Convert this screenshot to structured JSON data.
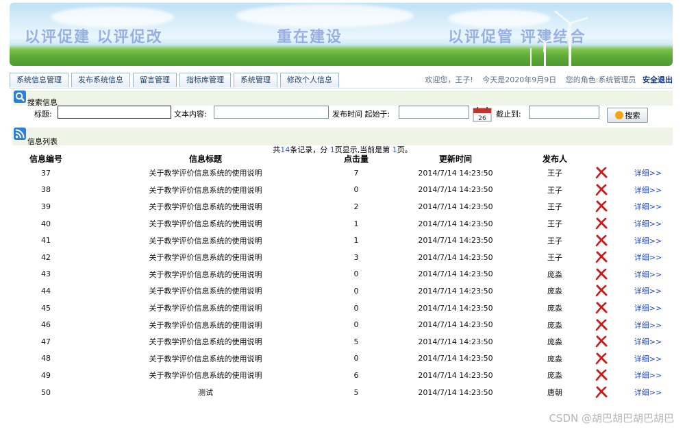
{
  "banner": {
    "slogans": [
      "以评促建  以评促改",
      "重在建设",
      "以评促管  评建结合"
    ]
  },
  "nav": {
    "tabs": [
      "系统信息管理",
      "发布系统信息",
      "留言管理",
      "指标库管理",
      "系统管理",
      "修改个人信息"
    ],
    "welcome": "欢迎您，王子!",
    "today": "今天是2020年9月9日",
    "role": "您的角色:系统管理员",
    "logout": "安全退出"
  },
  "search": {
    "section_title": "搜索信息",
    "title_label": "标题:",
    "title_value": "",
    "content_label": "文本内容:",
    "content_value": "",
    "start_label": "发布时间 起始于:",
    "start_value": "",
    "end_label": "截止到:",
    "end_value": "",
    "button_label": "搜索"
  },
  "list": {
    "section_title": "信息列表",
    "summary": {
      "pre": "共",
      "total": "14",
      "mid1": "条记录，分 ",
      "pages": "1",
      "mid2": "页显示,当前是第 ",
      "current": "1",
      "post": "页。"
    },
    "headers": [
      "信息编号",
      "信息标题",
      "点击量",
      "更新时间",
      "发布人"
    ],
    "detail_label": "详细>>",
    "rows": [
      {
        "id": "37",
        "title": "关于教学评价信息系统的使用说明",
        "clicks": "7",
        "time": "2014/7/14 14:23:50",
        "publisher": "王子"
      },
      {
        "id": "38",
        "title": "关于教学评价信息系统的使用说明",
        "clicks": "0",
        "time": "2014/7/14 14:23:50",
        "publisher": "王子"
      },
      {
        "id": "39",
        "title": "关于教学评价信息系统的使用说明",
        "clicks": "2",
        "time": "2014/7/14 14:23:50",
        "publisher": "王子"
      },
      {
        "id": "40",
        "title": "关于教学评价信息系统的使用说明",
        "clicks": "1",
        "time": "2014/7/14 14:23:50",
        "publisher": "王子"
      },
      {
        "id": "41",
        "title": "关于教学评价信息系统的使用说明",
        "clicks": "1",
        "time": "2014/7/14 14:23:50",
        "publisher": "王子"
      },
      {
        "id": "42",
        "title": "关于教学评价信息系统的使用说明",
        "clicks": "3",
        "time": "2014/7/14 14:23:50",
        "publisher": "王子"
      },
      {
        "id": "43",
        "title": "关于教学评价信息系统的使用说明",
        "clicks": "0",
        "time": "2014/7/14 14:23:50",
        "publisher": "庞淼"
      },
      {
        "id": "44",
        "title": "关于教学评价信息系统的使用说明",
        "clicks": "0",
        "time": "2014/7/14 14:23:50",
        "publisher": "庞淼"
      },
      {
        "id": "45",
        "title": "关于教学评价信息系统的使用说明",
        "clicks": "0",
        "time": "2014/7/14 14:23:50",
        "publisher": "庞淼"
      },
      {
        "id": "46",
        "title": "关于教学评价信息系统的使用说明",
        "clicks": "0",
        "time": "2014/7/14 14:23:50",
        "publisher": "庞淼"
      },
      {
        "id": "47",
        "title": "关于教学评价信息系统的使用说明",
        "clicks": "5",
        "time": "2014/7/14 14:23:50",
        "publisher": "庞淼"
      },
      {
        "id": "48",
        "title": "关于教学评价信息系统的使用说明",
        "clicks": "0",
        "time": "2014/7/14 14:23:50",
        "publisher": "庞淼"
      },
      {
        "id": "49",
        "title": "关于教学评价信息系统的使用说明",
        "clicks": "6",
        "time": "2014/7/14 14:23:50",
        "publisher": "庞淼"
      },
      {
        "id": "50",
        "title": "测试",
        "clicks": "5",
        "time": "2014/7/14 14:23:50",
        "publisher": "唐朝"
      }
    ]
  },
  "icons": {
    "search_section": "search-icon",
    "calendar": "calendar-icon",
    "list_section": "rss-icon",
    "delete": "red-x-delete-icon"
  },
  "watermark": "CSDN @胡巴胡巴胡巴胡巴"
}
